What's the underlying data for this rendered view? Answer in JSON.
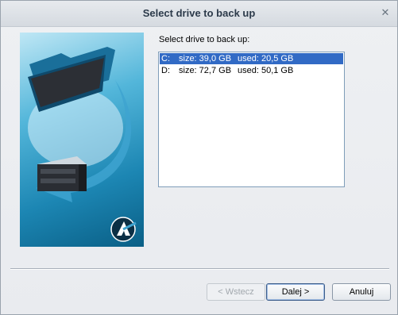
{
  "window": {
    "title": "Select drive to back up",
    "close_glyph": "✕"
  },
  "main": {
    "prompt": "Select drive to back up:",
    "drives": [
      {
        "letter": "C:",
        "size": "size: 39,0 GB",
        "used": "used: 20,5 GB",
        "selected": true
      },
      {
        "letter": "D:",
        "size": "size: 72,7 GB",
        "used": "used: 50,1 GB",
        "selected": false
      }
    ]
  },
  "buttons": {
    "back": "< Wstecz",
    "next": "Dalej >",
    "cancel": "Anuluj"
  },
  "colors": {
    "selection": "#316ac5",
    "hero_accent": "#1c86b3"
  },
  "icons": {
    "hero": "folder-to-server-backup-illustration",
    "logo": "acronis-logo-icon"
  }
}
